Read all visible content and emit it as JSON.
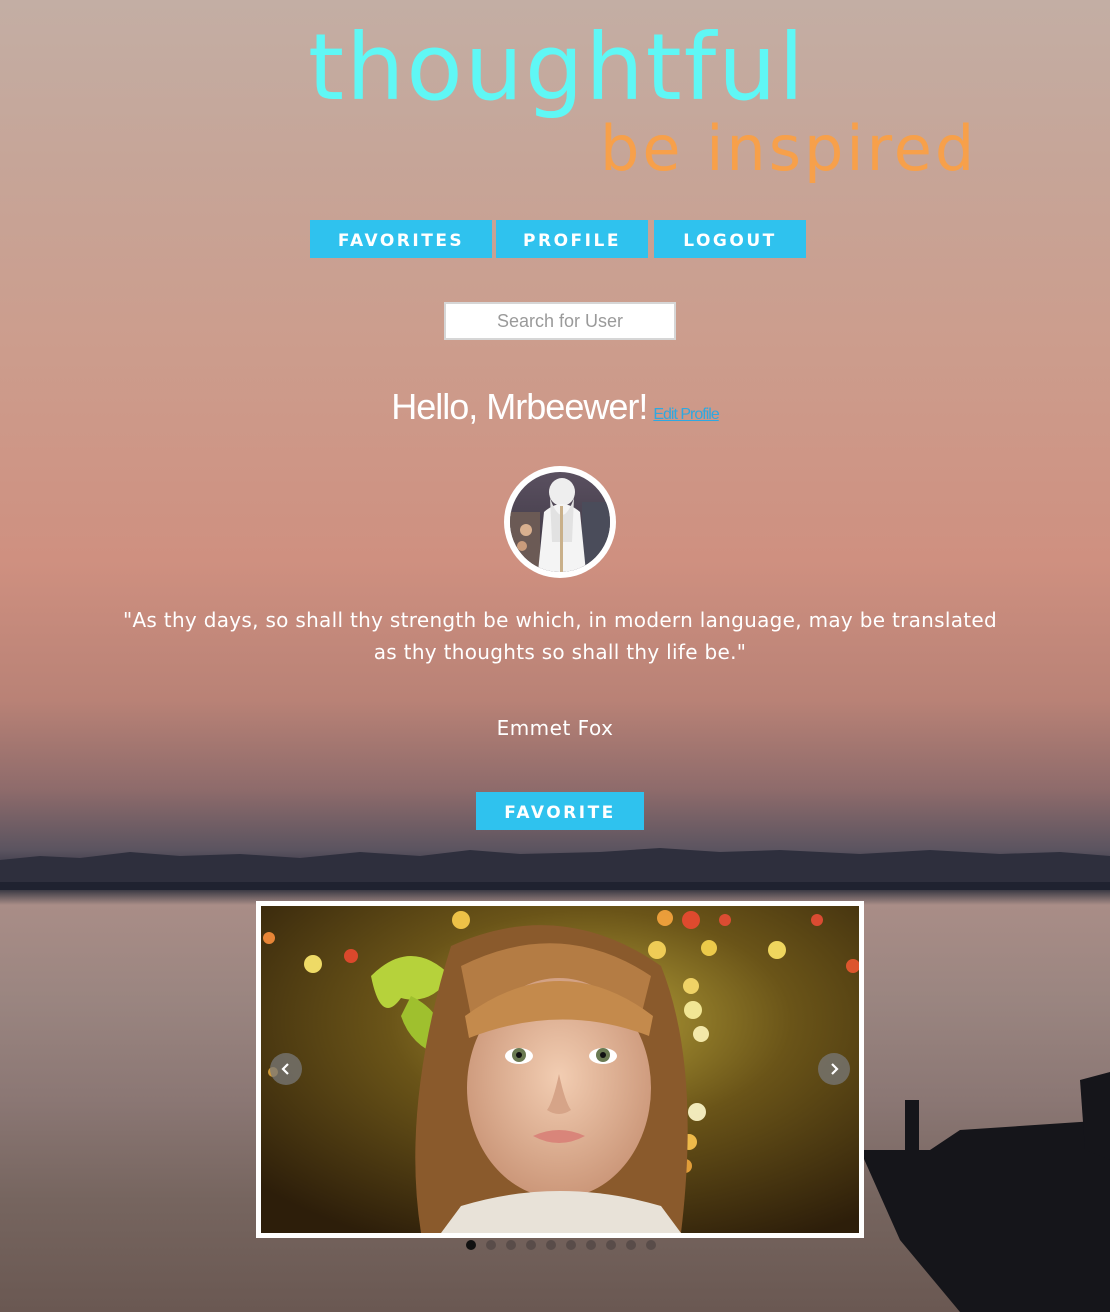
{
  "logo": {
    "title": "thoughtful",
    "tagline": "be inspired"
  },
  "nav": {
    "favorites_label": "FAVORITES",
    "profile_label": "PROFILE",
    "logout_label": "LOGOUT"
  },
  "search": {
    "placeholder": "Search for User"
  },
  "greeting": {
    "text": "Hello, Mrbeewer!",
    "edit_link": "Edit Profile"
  },
  "quote": {
    "text": "\"As thy days, so shall thy strength be which, in modern language, may be translated as thy thoughts so shall thy life be.\"",
    "author": "Emmet Fox"
  },
  "favorite_button": "FAVORITE",
  "carousel": {
    "slide_count": 10,
    "active_index": 0,
    "prev_icon": "chevron-left-icon",
    "next_icon": "chevron-right-icon"
  },
  "colors": {
    "accent": "#2fc2ee",
    "logo_title": "#5ff7f5",
    "logo_tagline": "#f7a04a",
    "link": "#2fa8e0"
  }
}
